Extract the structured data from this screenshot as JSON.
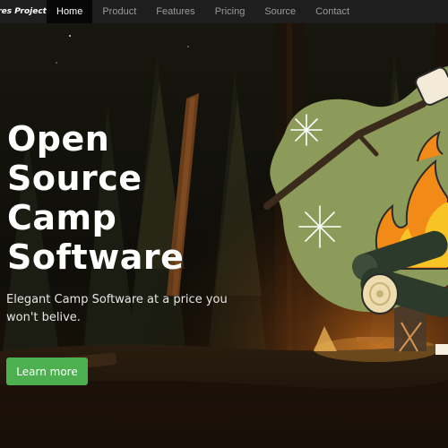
{
  "navbar": {
    "brand": "res Project",
    "items": [
      {
        "label": "Home",
        "active": true
      },
      {
        "label": "Product",
        "active": false
      },
      {
        "label": "Features",
        "active": false
      },
      {
        "label": "Pricing",
        "active": false
      },
      {
        "label": "Source",
        "active": false
      },
      {
        "label": "Contact",
        "active": false
      }
    ]
  },
  "hero": {
    "title": "Open\nSource\nCamp\nSoftware",
    "subtitle": "Elegant Camp Software at a price you won't belive.",
    "cta_label": "Learn more"
  },
  "icons": {
    "illustration": "campfire-illustration-icon",
    "sparkles": "sparkle-icon",
    "marshmallow": "marshmallow-icon"
  },
  "colors": {
    "navbar_bg": "#1e1e1e",
    "nav_active_bg": "#070707",
    "nav_text": "#9a9a9a",
    "blob_green": "#8c9a5a",
    "flame_orange": "#f28a17",
    "flame_yellow": "#f7c325",
    "log_dark": "#2c3a2c",
    "log_light": "#ecdcae",
    "cta_green": "#4caf50"
  }
}
